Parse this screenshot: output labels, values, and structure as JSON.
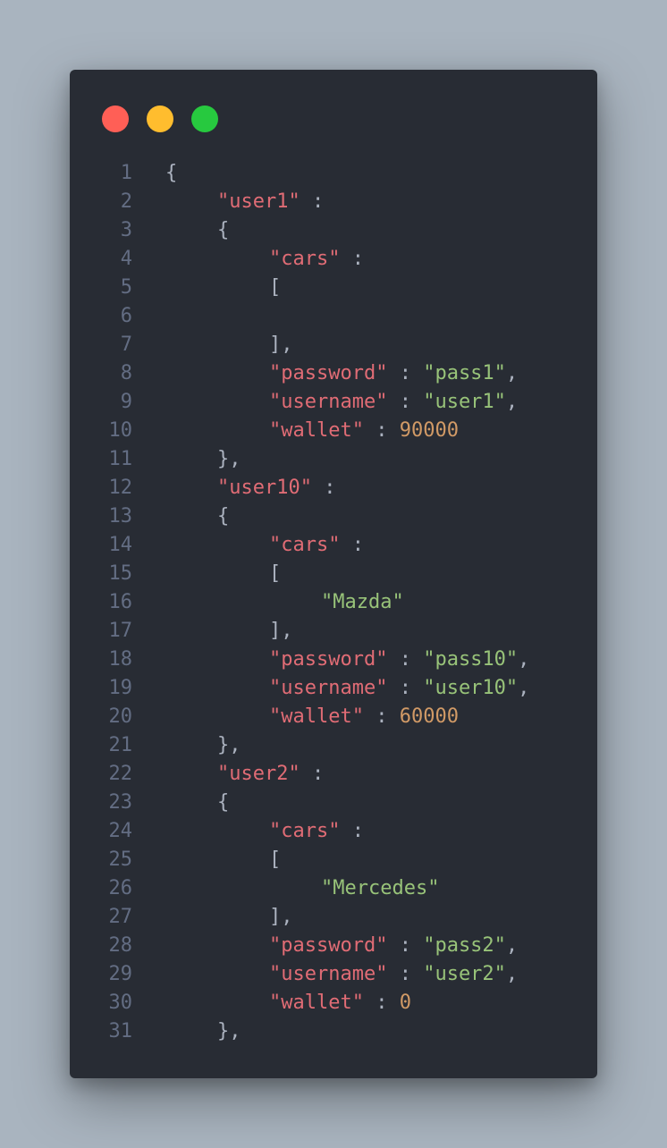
{
  "colors": {
    "background": "#a9b4bf",
    "window": "#282c34",
    "line_number": "#636d83",
    "key": "#e06c75",
    "string": "#98c379",
    "number": "#d19a66",
    "punctuation": "#abb2bf",
    "close_button": "#ff5f56",
    "minimize_button": "#ffbd2e",
    "maximize_button": "#27c93f"
  },
  "window_controls": [
    {
      "name": "close-button",
      "icon": "red-circle"
    },
    {
      "name": "minimize-button",
      "icon": "yellow-circle"
    },
    {
      "name": "maximize-button",
      "icon": "green-circle"
    }
  ],
  "code_lines": [
    {
      "n": "1",
      "indent": 0,
      "tokens": [
        {
          "t": "{",
          "c": "punc"
        }
      ]
    },
    {
      "n": "2",
      "indent": 1,
      "tokens": [
        {
          "t": "\"user1\"",
          "c": "key"
        },
        {
          "t": " :",
          "c": "punc"
        }
      ]
    },
    {
      "n": "3",
      "indent": 1,
      "tokens": [
        {
          "t": "{",
          "c": "punc"
        }
      ]
    },
    {
      "n": "4",
      "indent": 2,
      "tokens": [
        {
          "t": "\"cars\"",
          "c": "key"
        },
        {
          "t": " :",
          "c": "punc"
        }
      ]
    },
    {
      "n": "5",
      "indent": 2,
      "tokens": [
        {
          "t": "[",
          "c": "punc"
        }
      ]
    },
    {
      "n": "6",
      "indent": 0,
      "tokens": []
    },
    {
      "n": "7",
      "indent": 2,
      "tokens": [
        {
          "t": "],",
          "c": "punc"
        }
      ]
    },
    {
      "n": "8",
      "indent": 2,
      "tokens": [
        {
          "t": "\"password\"",
          "c": "key"
        },
        {
          "t": " : ",
          "c": "punc"
        },
        {
          "t": "\"pass1\"",
          "c": "str"
        },
        {
          "t": ",",
          "c": "punc"
        }
      ]
    },
    {
      "n": "9",
      "indent": 2,
      "tokens": [
        {
          "t": "\"username\"",
          "c": "key"
        },
        {
          "t": " : ",
          "c": "punc"
        },
        {
          "t": "\"user1\"",
          "c": "str"
        },
        {
          "t": ",",
          "c": "punc"
        }
      ]
    },
    {
      "n": "10",
      "indent": 2,
      "tokens": [
        {
          "t": "\"wallet\"",
          "c": "key"
        },
        {
          "t": " : ",
          "c": "punc"
        },
        {
          "t": "90000",
          "c": "num"
        }
      ]
    },
    {
      "n": "11",
      "indent": 1,
      "tokens": [
        {
          "t": "},",
          "c": "punc"
        }
      ]
    },
    {
      "n": "12",
      "indent": 1,
      "tokens": [
        {
          "t": "\"user10\"",
          "c": "key"
        },
        {
          "t": " :",
          "c": "punc"
        }
      ]
    },
    {
      "n": "13",
      "indent": 1,
      "tokens": [
        {
          "t": "{",
          "c": "punc"
        }
      ]
    },
    {
      "n": "14",
      "indent": 2,
      "tokens": [
        {
          "t": "\"cars\"",
          "c": "key"
        },
        {
          "t": " :",
          "c": "punc"
        }
      ]
    },
    {
      "n": "15",
      "indent": 2,
      "tokens": [
        {
          "t": "[",
          "c": "punc"
        }
      ]
    },
    {
      "n": "16",
      "indent": 3,
      "tokens": [
        {
          "t": "\"Mazda\"",
          "c": "str"
        }
      ]
    },
    {
      "n": "17",
      "indent": 2,
      "tokens": [
        {
          "t": "],",
          "c": "punc"
        }
      ]
    },
    {
      "n": "18",
      "indent": 2,
      "tokens": [
        {
          "t": "\"password\"",
          "c": "key"
        },
        {
          "t": " : ",
          "c": "punc"
        },
        {
          "t": "\"pass10\"",
          "c": "str"
        },
        {
          "t": ",",
          "c": "punc"
        }
      ]
    },
    {
      "n": "19",
      "indent": 2,
      "tokens": [
        {
          "t": "\"username\"",
          "c": "key"
        },
        {
          "t": " : ",
          "c": "punc"
        },
        {
          "t": "\"user10\"",
          "c": "str"
        },
        {
          "t": ",",
          "c": "punc"
        }
      ]
    },
    {
      "n": "20",
      "indent": 2,
      "tokens": [
        {
          "t": "\"wallet\"",
          "c": "key"
        },
        {
          "t": " : ",
          "c": "punc"
        },
        {
          "t": "60000",
          "c": "num"
        }
      ]
    },
    {
      "n": "21",
      "indent": 1,
      "tokens": [
        {
          "t": "},",
          "c": "punc"
        }
      ]
    },
    {
      "n": "22",
      "indent": 1,
      "tokens": [
        {
          "t": "\"user2\"",
          "c": "key"
        },
        {
          "t": " :",
          "c": "punc"
        }
      ]
    },
    {
      "n": "23",
      "indent": 1,
      "tokens": [
        {
          "t": "{",
          "c": "punc"
        }
      ]
    },
    {
      "n": "24",
      "indent": 2,
      "tokens": [
        {
          "t": "\"cars\"",
          "c": "key"
        },
        {
          "t": " :",
          "c": "punc"
        }
      ]
    },
    {
      "n": "25",
      "indent": 2,
      "tokens": [
        {
          "t": "[",
          "c": "punc"
        }
      ]
    },
    {
      "n": "26",
      "indent": 3,
      "tokens": [
        {
          "t": "\"Mercedes\"",
          "c": "str"
        }
      ]
    },
    {
      "n": "27",
      "indent": 2,
      "tokens": [
        {
          "t": "],",
          "c": "punc"
        }
      ]
    },
    {
      "n": "28",
      "indent": 2,
      "tokens": [
        {
          "t": "\"password\"",
          "c": "key"
        },
        {
          "t": " : ",
          "c": "punc"
        },
        {
          "t": "\"pass2\"",
          "c": "str"
        },
        {
          "t": ",",
          "c": "punc"
        }
      ]
    },
    {
      "n": "29",
      "indent": 2,
      "tokens": [
        {
          "t": "\"username\"",
          "c": "key"
        },
        {
          "t": " : ",
          "c": "punc"
        },
        {
          "t": "\"user2\"",
          "c": "str"
        },
        {
          "t": ",",
          "c": "punc"
        }
      ]
    },
    {
      "n": "30",
      "indent": 2,
      "tokens": [
        {
          "t": "\"wallet\"",
          "c": "key"
        },
        {
          "t": " : ",
          "c": "punc"
        },
        {
          "t": "0",
          "c": "num"
        }
      ]
    },
    {
      "n": "31",
      "indent": 1,
      "tokens": [
        {
          "t": "},",
          "c": "punc"
        }
      ]
    }
  ]
}
